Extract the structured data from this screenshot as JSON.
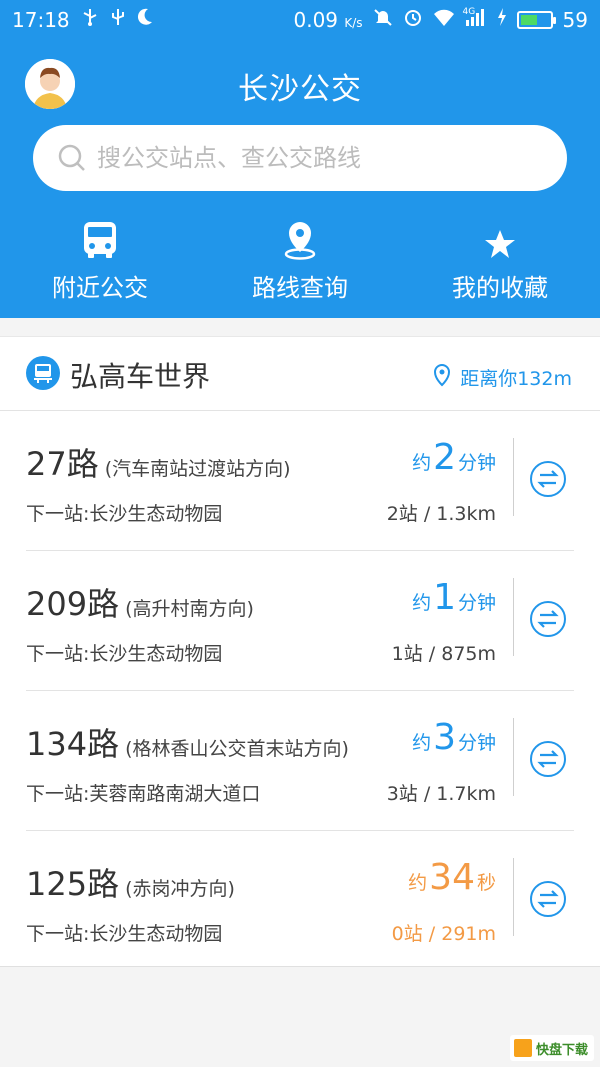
{
  "status_bar": {
    "time": "17:18",
    "net_speed": "0.09",
    "net_speed_unit": "K/s",
    "network": "4G",
    "battery": "59",
    "battery_fraction": 0.59,
    "left_icons": [
      "usb-icon",
      "usb-debug-icon",
      "moon-icon"
    ],
    "right_icons": [
      "mute-icon",
      "alarm-icon",
      "wifi-icon",
      "signal-icon",
      "charging-icon",
      "battery-icon"
    ]
  },
  "header": {
    "title": "长沙公交",
    "search_placeholder": "搜公交站点、查公交路线"
  },
  "nav": [
    {
      "icon": "bus-icon",
      "label": "附近公交"
    },
    {
      "icon": "location-pin-icon",
      "label": "路线查询"
    },
    {
      "icon": "star-icon",
      "label": "我的收藏"
    }
  ],
  "stop": {
    "name": "弘高车世界",
    "distance": "距离你132m"
  },
  "routes": [
    {
      "number": "27路",
      "direction": "(汽车南站过渡站方向)",
      "eta_prefix": "约",
      "eta_value": "2",
      "eta_unit": "分钟",
      "next_stop": "下一站:长沙生态动物园",
      "stops_distance": "2站 / 1.3km",
      "highlight": false
    },
    {
      "number": "209路",
      "direction": "(高升村南方向)",
      "eta_prefix": "约",
      "eta_value": "1",
      "eta_unit": "分钟",
      "next_stop": "下一站:长沙生态动物园",
      "stops_distance": "1站 / 875m",
      "highlight": false
    },
    {
      "number": "134路",
      "direction": "(格林香山公交首末站方向)",
      "eta_prefix": "约",
      "eta_value": "3",
      "eta_unit": "分钟",
      "next_stop": "下一站:芙蓉南路南湖大道口",
      "stops_distance": "3站 / 1.7km",
      "highlight": false
    },
    {
      "number": "125路",
      "direction": "(赤岗冲方向)",
      "eta_prefix": "约",
      "eta_value": "34",
      "eta_unit": "秒",
      "next_stop": "下一站:长沙生态动物园",
      "stops_distance": "0站 / 291m",
      "highlight": true
    }
  ],
  "watermark": {
    "text": "快盘下载"
  },
  "colors": {
    "primary": "#2196ea",
    "accent_orange": "#f39a45",
    "background": "#f4f4f4"
  }
}
